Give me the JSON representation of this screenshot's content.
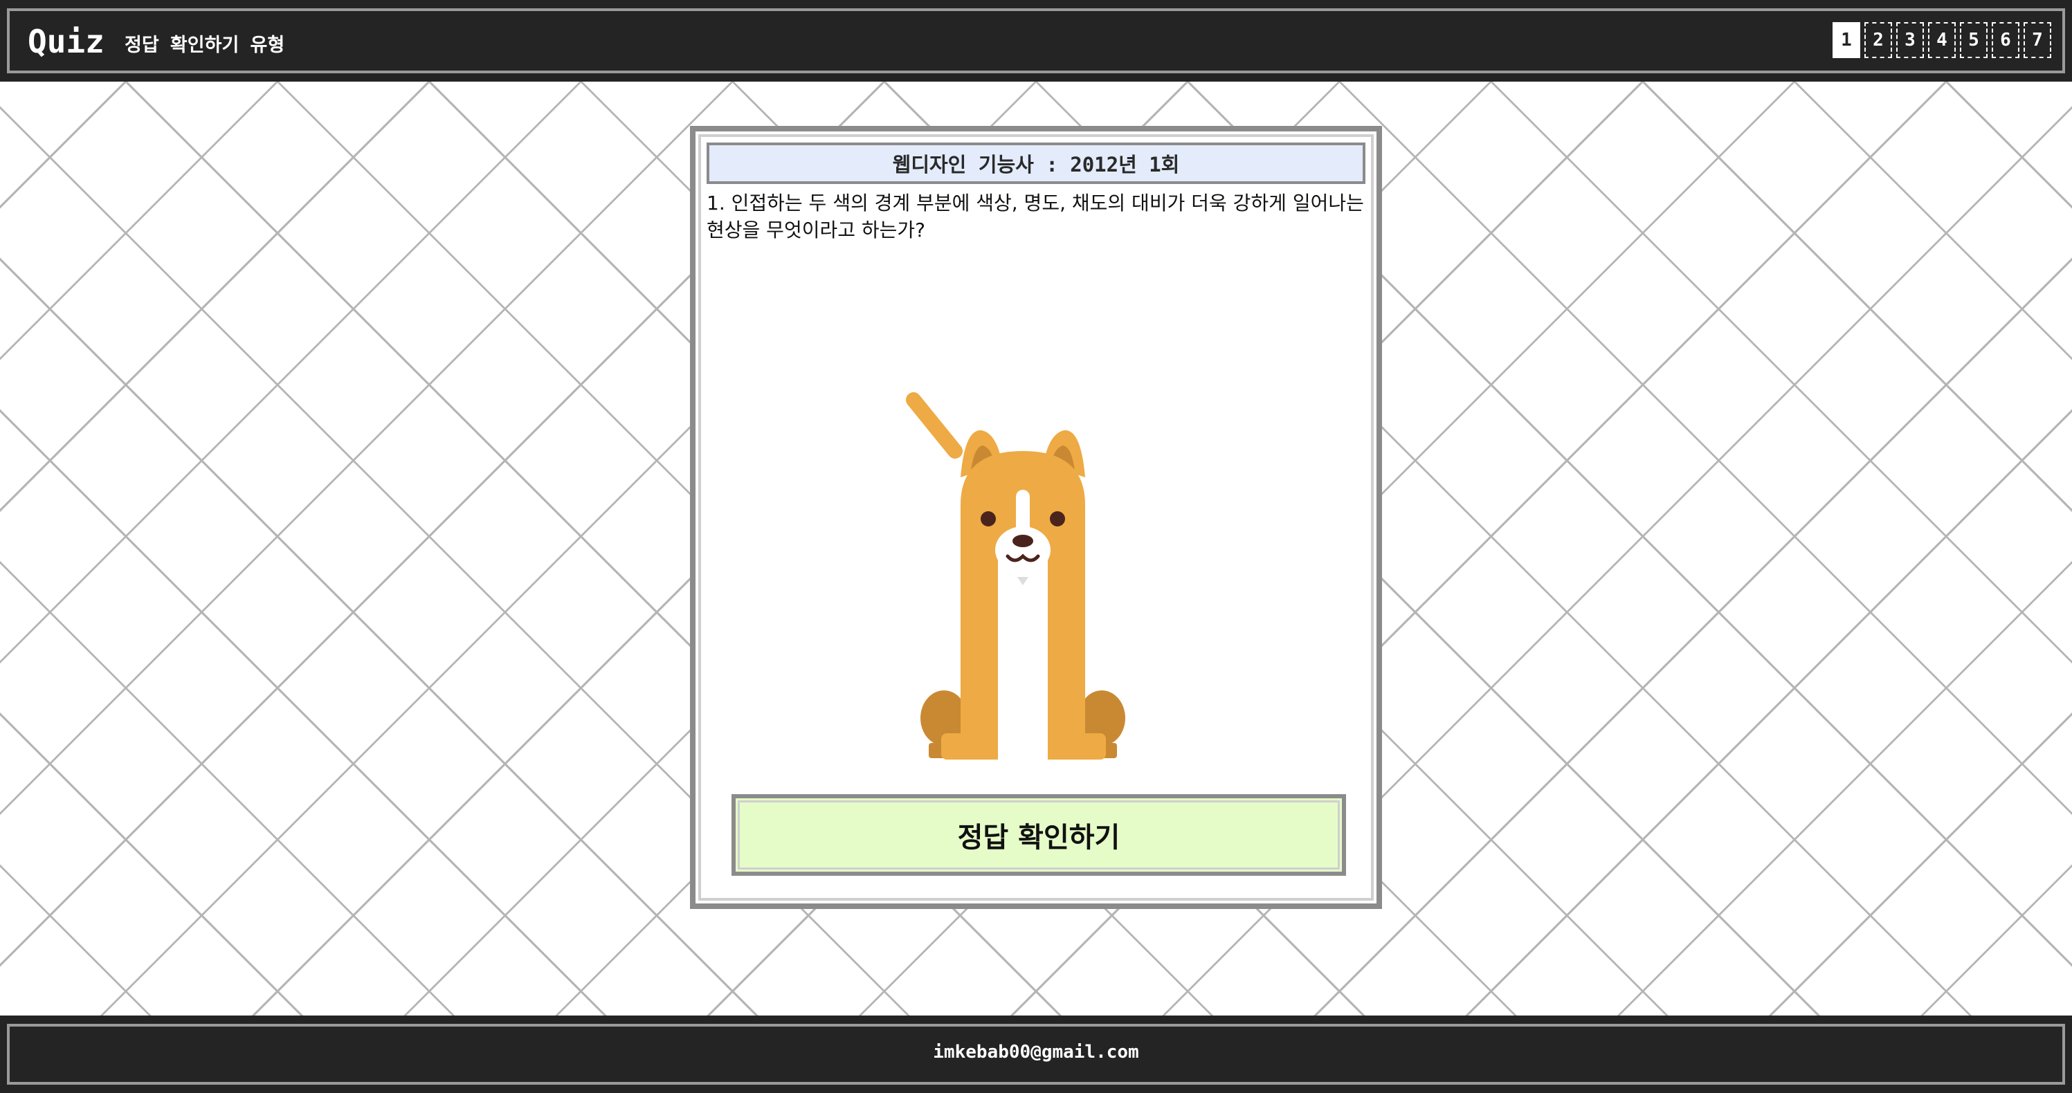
{
  "header": {
    "logo": "Quiz",
    "subtitle": "정답 확인하기 유형",
    "pages": [
      "1",
      "2",
      "3",
      "4",
      "5",
      "6",
      "7"
    ],
    "active_page": "1"
  },
  "quiz": {
    "title": "웹디자인 기능사 : 2012년 1회",
    "question": "1. 인접하는 두 색의 경계 부분에 색상, 명도, 채도의 대비가 더욱 강하게 일어나는 현상을 무엇이라고 하는가?",
    "illustration": "dog-illustration",
    "answer_button_label": "정답 확인하기"
  },
  "footer": {
    "email": "imkebab00@gmail.com"
  },
  "colors": {
    "header_bg": "#242424",
    "card_title_bg": "#e4ecfc",
    "answer_button_bg": "#e6fcc8",
    "dog_body": "#eeaa44",
    "dog_dark": "#c98933"
  }
}
